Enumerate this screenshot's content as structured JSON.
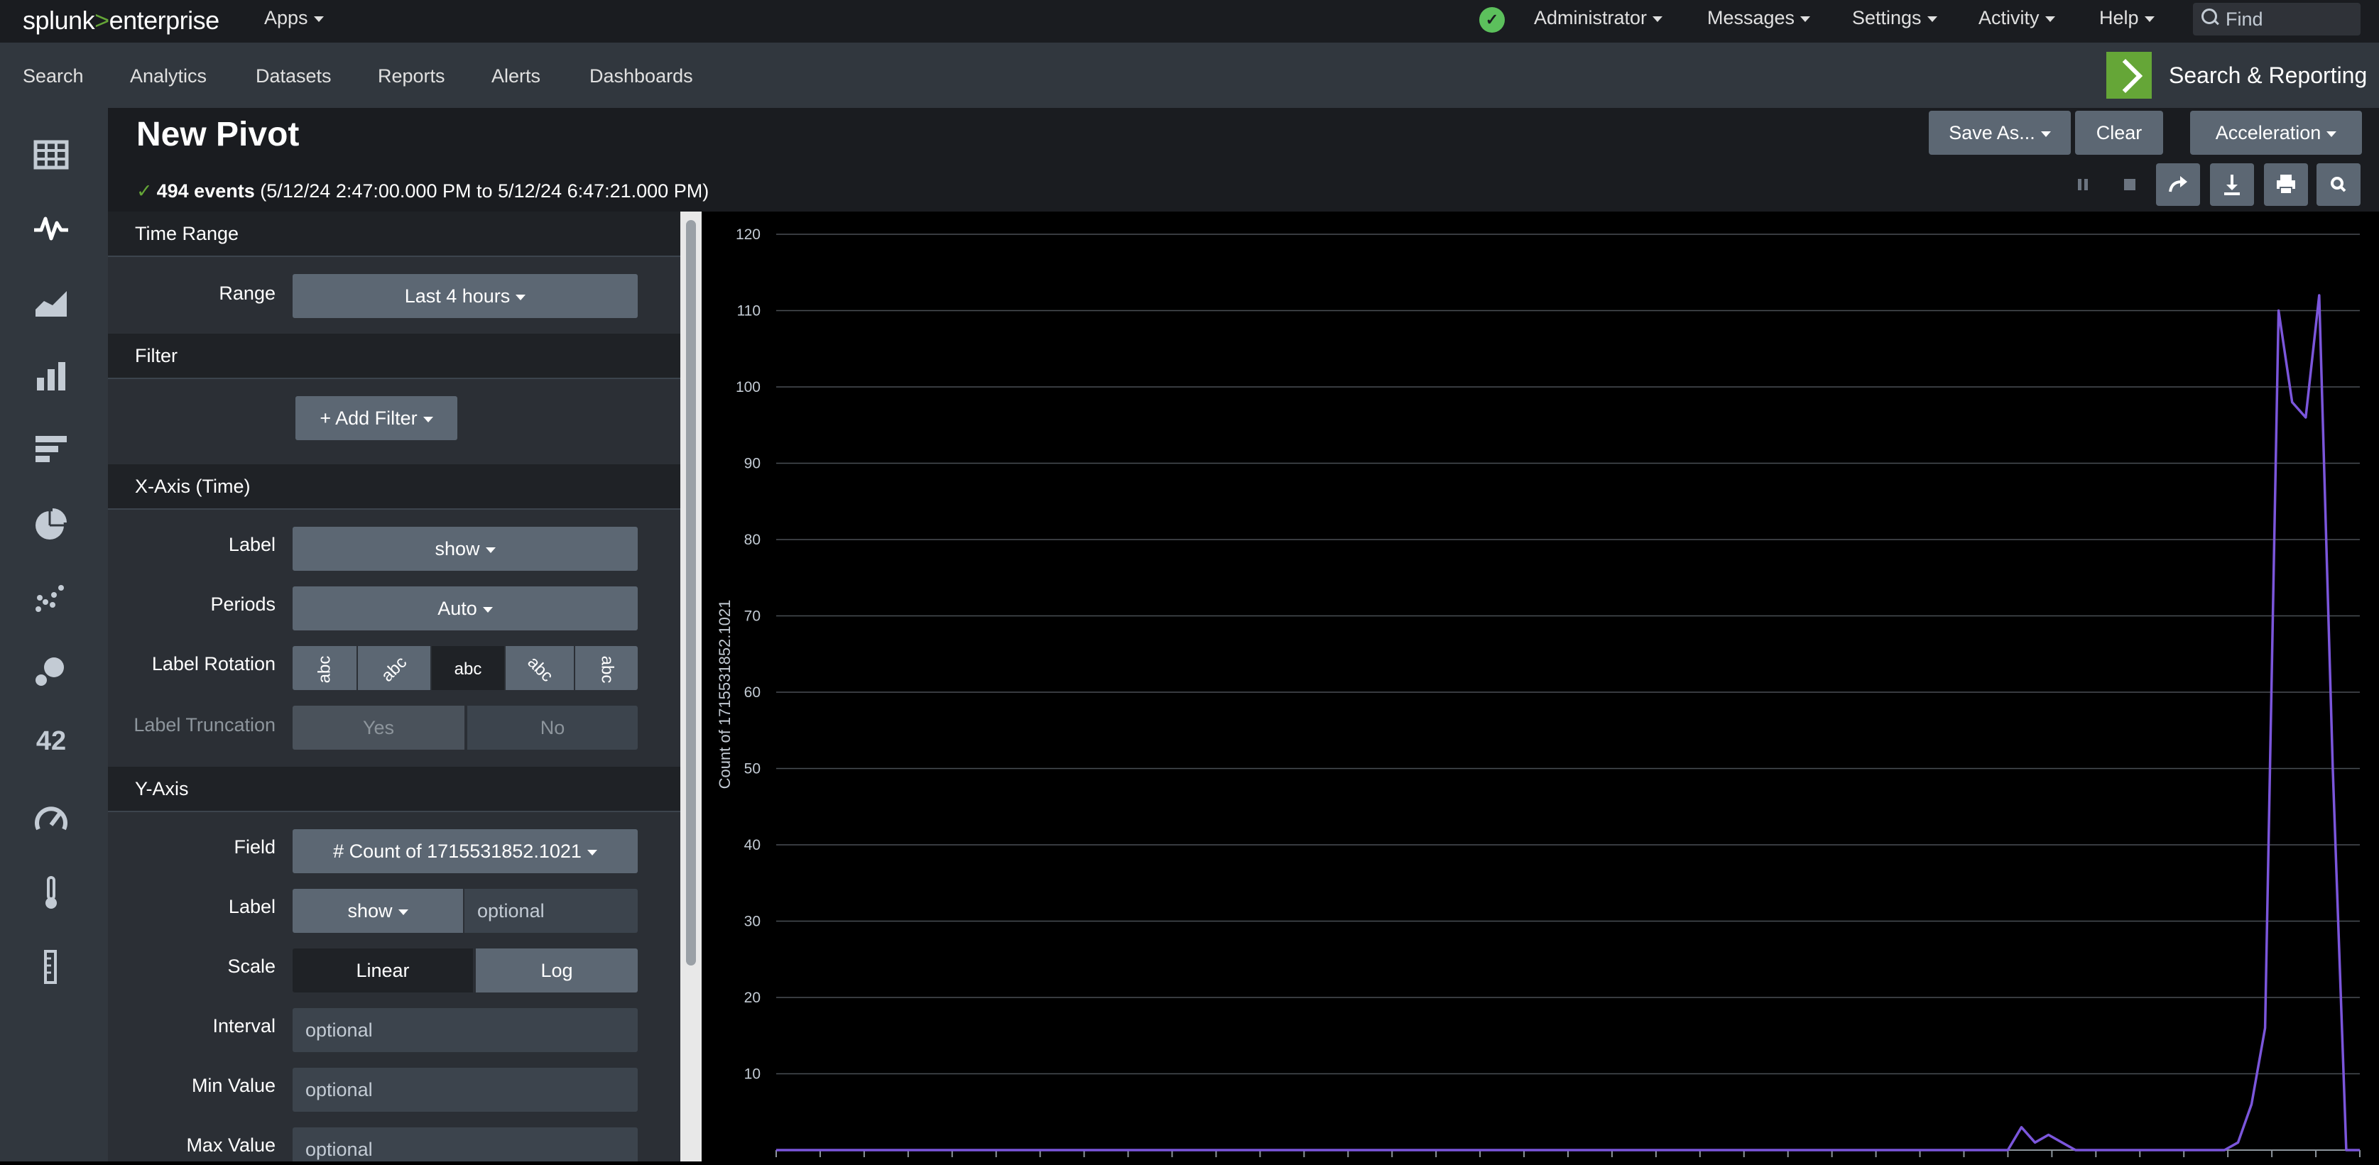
{
  "topbar": {
    "logo_left": "splunk",
    "logo_gt": ">",
    "logo_right": "enterprise",
    "apps": "Apps",
    "user": "Administrator",
    "messages": "Messages",
    "settings": "Settings",
    "activity": "Activity",
    "help": "Help",
    "find_placeholder": "Find"
  },
  "appbar": {
    "nav": [
      "Search",
      "Analytics",
      "Datasets",
      "Reports",
      "Alerts",
      "Dashboards"
    ],
    "app_name": "Search & Reporting"
  },
  "rail_icons": [
    "table-icon",
    "pulse-icon",
    "area-chart-icon",
    "bar-chart-icon",
    "horizontal-bar-icon",
    "pie-chart-icon",
    "scatter-icon",
    "bubble-icon",
    "single-value-icon",
    "gauge-icon",
    "thermometer-icon",
    "filler-gauge-icon"
  ],
  "rail_single_value": "42",
  "header": {
    "title": "New Pivot",
    "events_count": "494 events",
    "events_range": "(5/12/24 2:47:00.000 PM to 5/12/24 6:47:21.000 PM)",
    "save_as": "Save As...",
    "clear": "Clear",
    "acceleration": "Acceleration"
  },
  "panel": {
    "time_range": "Time Range",
    "range_label": "Range",
    "range_value": "Last 4 hours",
    "filter": "Filter",
    "add_filter": "+ Add Filter",
    "xaxis": "X-Axis (Time)",
    "x_label_label": "Label",
    "x_label_value": "show",
    "periods_label": "Periods",
    "periods_value": "Auto",
    "rotation_label": "Label Rotation",
    "rotation_options": [
      "abc",
      "abc",
      "abc",
      "abc",
      "abc"
    ],
    "truncation_label": "Label Truncation",
    "truncation_yes": "Yes",
    "truncation_no": "No",
    "yaxis": "Y-Axis",
    "field_label": "Field",
    "field_value": "# Count of 1715531852.1021",
    "y_label_label": "Label",
    "y_label_value": "show",
    "y_label_placeholder": "optional",
    "scale_label": "Scale",
    "scale_linear": "Linear",
    "scale_log": "Log",
    "interval_label": "Interval",
    "interval_placeholder": "optional",
    "min_label": "Min Value",
    "min_placeholder": "optional",
    "max_label": "Max Value",
    "max_placeholder": "optional"
  },
  "colors": {
    "series": "#7b56db",
    "accent_green": "#65a637",
    "button_gray": "#5c6773"
  },
  "chart_data": {
    "type": "line",
    "ylabel": "Count of 1715531852.1021",
    "xlabel": "",
    "ylim": [
      0,
      120
    ],
    "yticks": [
      10,
      20,
      30,
      40,
      50,
      60,
      70,
      80,
      90,
      100,
      110,
      120
    ],
    "grid": true,
    "legend": "none",
    "series": [
      {
        "values": [
          0,
          0,
          0,
          0,
          0,
          0,
          0,
          0,
          0,
          0,
          0,
          0,
          0,
          0,
          0,
          0,
          0,
          0,
          0,
          0,
          0,
          0,
          0,
          0,
          0,
          0,
          0,
          0,
          0,
          0,
          0,
          0,
          0,
          0,
          0,
          0,
          0,
          0,
          0,
          0,
          0,
          0,
          0,
          0,
          0,
          0,
          0,
          0,
          0,
          0,
          0,
          0,
          0,
          0,
          0,
          0,
          0,
          0,
          0,
          0,
          0,
          0,
          0,
          0,
          0,
          0,
          0,
          0,
          0,
          0,
          0,
          0,
          0,
          0,
          0,
          0,
          0,
          0,
          0,
          0,
          0,
          0,
          0,
          0,
          0,
          0,
          0,
          0,
          0,
          0,
          0,
          0,
          3,
          1,
          2,
          1,
          0,
          0,
          0,
          0,
          0,
          0,
          0,
          0,
          0,
          0,
          0,
          0,
          1,
          6,
          16,
          110,
          98,
          96,
          112,
          50,
          0,
          0
        ]
      }
    ]
  }
}
